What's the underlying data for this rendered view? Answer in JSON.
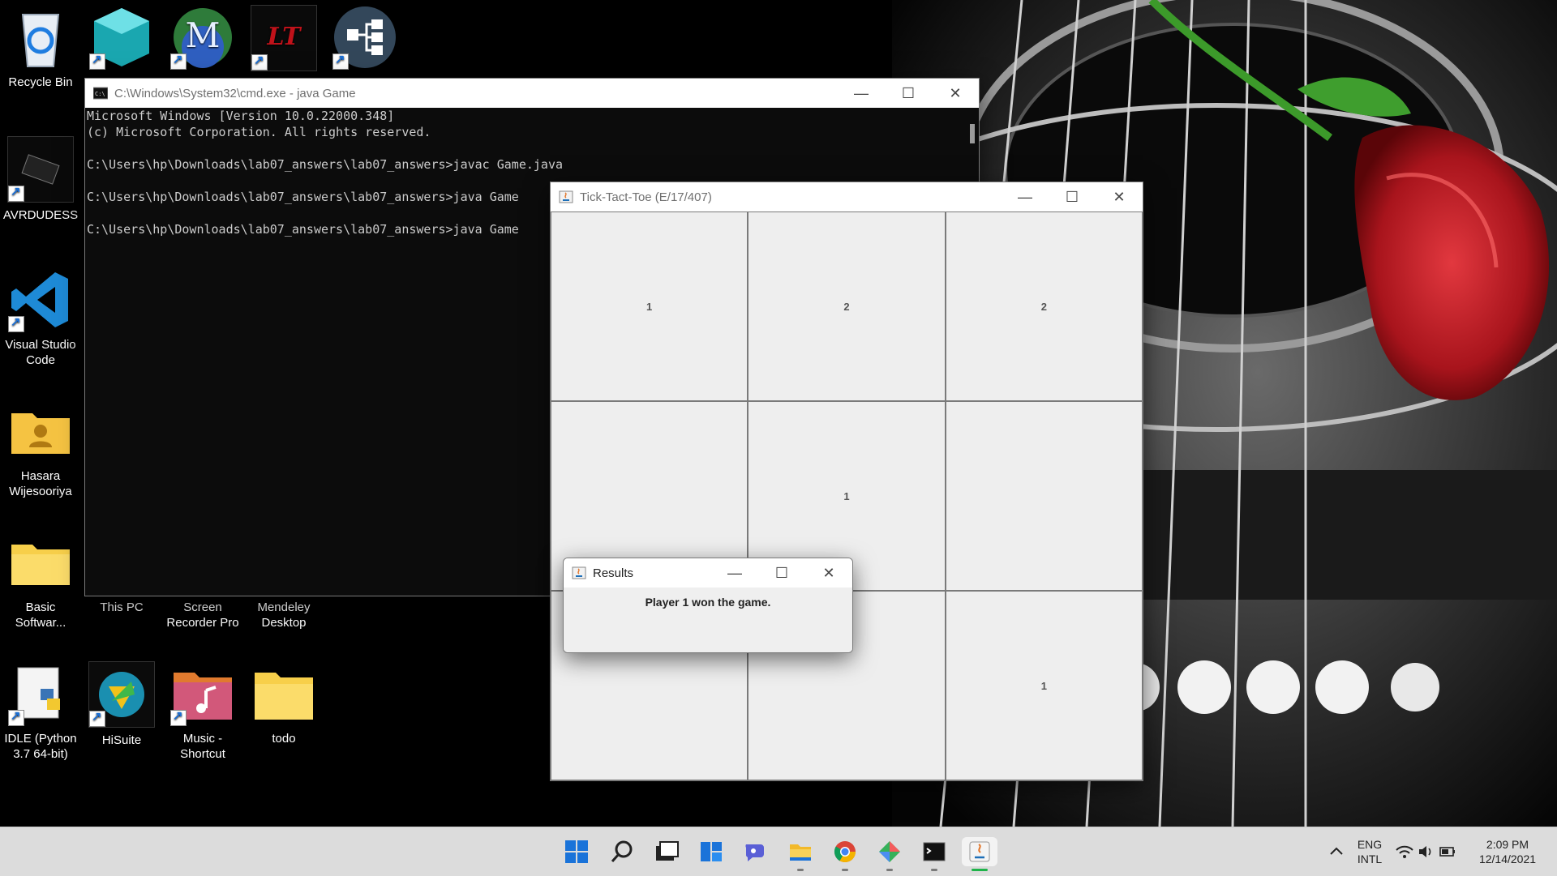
{
  "desktop": {
    "icons": [
      {
        "label": "Recycle Bin"
      },
      {
        "label": "AVRDUDESS"
      },
      {
        "label": "Visual Studio Code"
      },
      {
        "label": "Hasara Wijesooriya"
      },
      {
        "label": "Basic Softwar..."
      },
      {
        "label": "This PC"
      },
      {
        "label": "Screen Recorder Pro"
      },
      {
        "label": "Mendeley Desktop"
      },
      {
        "label": "IDLE (Python 3.7 64-bit)"
      },
      {
        "label": "HiSuite"
      },
      {
        "label": "Music - Shortcut"
      },
      {
        "label": "todo"
      }
    ]
  },
  "cmd_window": {
    "title": "C:\\Windows\\System32\\cmd.exe - java  Game",
    "lines": [
      "Microsoft Windows [Version 10.0.22000.348]",
      "(c) Microsoft Corporation. All rights reserved.",
      "",
      "C:\\Users\\hp\\Downloads\\lab07_answers\\lab07_answers>javac Game.java",
      "",
      "C:\\Users\\hp\\Downloads\\lab07_answers\\lab07_answers>java Game",
      "",
      "C:\\Users\\hp\\Downloads\\lab07_answers\\lab07_answers>java Game"
    ]
  },
  "game_window": {
    "title": "Tick-Tact-Toe (E/17/407)",
    "cells": [
      "1",
      "2",
      "2",
      "",
      "1",
      "",
      "",
      "",
      "1"
    ]
  },
  "results_dialog": {
    "title": "Results",
    "message": "Player 1 won the game."
  },
  "taskbar": {
    "language": "ENG",
    "layout": "INTL",
    "time": "2:09 PM",
    "date": "12/14/2021"
  }
}
